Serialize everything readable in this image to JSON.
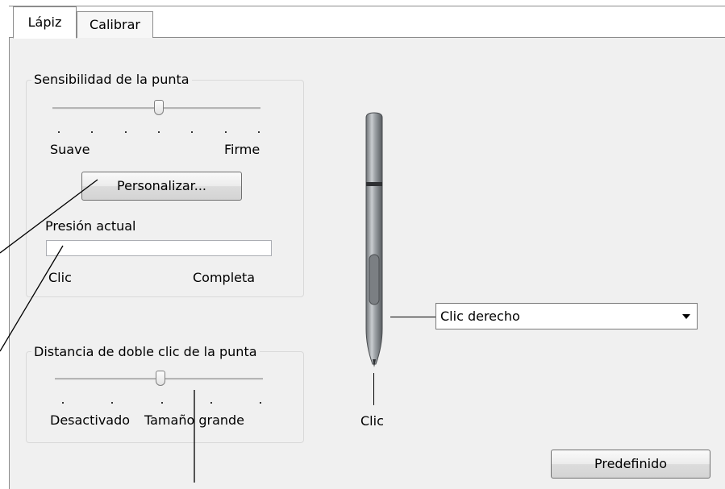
{
  "tabs": [
    {
      "label": "Lápiz",
      "active": true
    },
    {
      "label": "Calibrar",
      "active": false
    }
  ],
  "tip_feel": {
    "title": "Sensibilidad de la punta",
    "slider": {
      "ticks": 7,
      "value_step": 4
    },
    "left_label": "Suave",
    "right_label": "Firme",
    "customize_button": "Personalizar...",
    "pressure_label": "Presión actual",
    "pressure_value": 0,
    "pressure_left": "Clic",
    "pressure_right": "Completa"
  },
  "double_click": {
    "title": "Distancia de doble clic de la punta",
    "slider": {
      "ticks": 5,
      "value_step": 3
    },
    "left_label": "Desactivado",
    "right_label": "Tamaño grande"
  },
  "pen": {
    "side_switch_value": "Clic derecho",
    "tip_label": "Clic"
  },
  "default_button": "Predefinido",
  "colors": {
    "panel": "#f0f0f0",
    "border": "#8c8c8c",
    "pen_body": "#8f9397"
  }
}
